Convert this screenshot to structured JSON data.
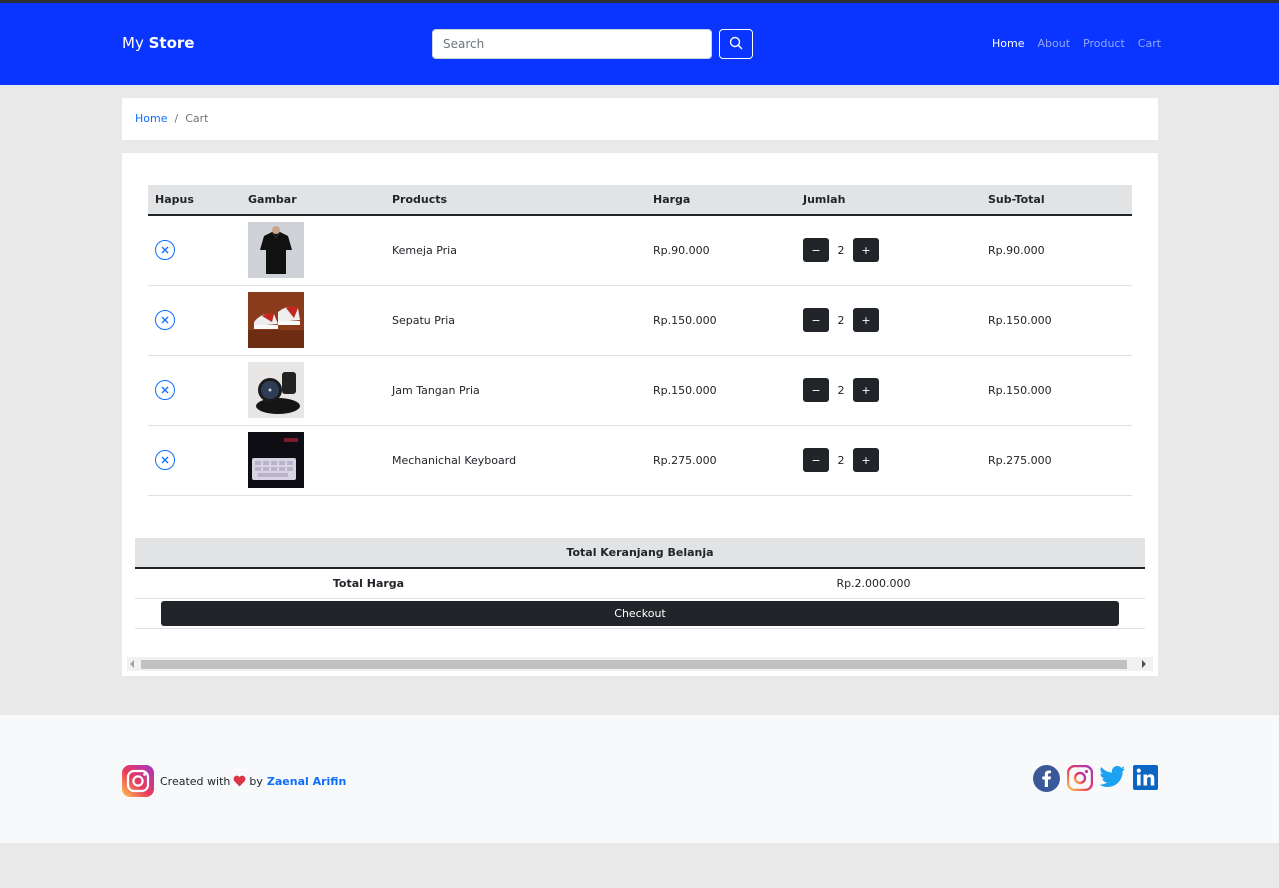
{
  "navbar": {
    "brand_prefix": "My",
    "brand_bold": "Store",
    "search_placeholder": "Search",
    "links": [
      {
        "label": "Home",
        "active": true
      },
      {
        "label": "About",
        "active": false
      },
      {
        "label": "Product",
        "active": false
      },
      {
        "label": "Cart",
        "active": false
      }
    ],
    "color": "#0a35ff"
  },
  "breadcrumb": {
    "home": "Home",
    "separator": "/",
    "current": "Cart"
  },
  "cart_table": {
    "headers": [
      "Hapus",
      "Gambar",
      "Products",
      "Harga",
      "Jumlah",
      "Sub-Total"
    ],
    "rows": [
      {
        "product": "Kemeja Pria",
        "price": "Rp.90.000",
        "qty": "2",
        "subtotal": "Rp.90.000",
        "image": "black-shirt"
      },
      {
        "product": "Sepatu Pria",
        "price": "Rp.150.000",
        "qty": "2",
        "subtotal": "Rp.150.000",
        "image": "sneakers"
      },
      {
        "product": "Jam Tangan Pria",
        "price": "Rp.150.000",
        "qty": "2",
        "subtotal": "Rp.150.000",
        "image": "wristwatch"
      },
      {
        "product": "Mechanichal Keyboard",
        "price": "Rp.275.000",
        "qty": "2",
        "subtotal": "Rp.275.000",
        "image": "keyboard"
      }
    ],
    "minus_label": "−",
    "plus_label": "+"
  },
  "summary": {
    "heading": "Total Keranjang Belanja",
    "total_label": "Total Harga",
    "total_value": "Rp.2.000.000",
    "checkout_label": "Checkout"
  },
  "footer": {
    "created_with": "Created with",
    "by": "by",
    "author": "Zaenal Arifin",
    "social_icons": [
      "facebook-icon",
      "instagram-icon",
      "twitter-icon",
      "linkedin-icon"
    ]
  }
}
